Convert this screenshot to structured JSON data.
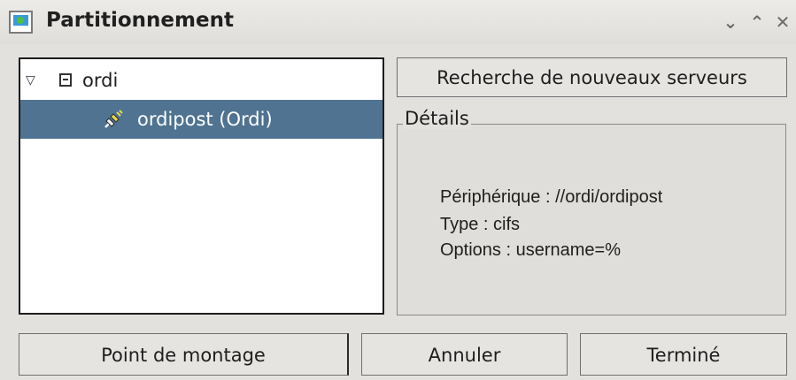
{
  "window": {
    "title": "Partitionnement",
    "controls": {
      "minimize": "⌄",
      "maximize": "⌃",
      "close": "✕"
    }
  },
  "tree": {
    "root": {
      "expander": "▽",
      "icon": "computer-icon",
      "label": "ordi"
    },
    "children": [
      {
        "icon": "network-share-icon",
        "label": "ordipost (Ordi)",
        "selected": true
      }
    ]
  },
  "search_button": "Recherche de nouveaux serveurs",
  "details": {
    "legend": "Détails",
    "lines": [
      "Périphérique : //ordi/ordipost",
      "Type : cifs",
      "Options : username=%"
    ]
  },
  "buttons": {
    "mount": "Point de montage",
    "cancel": "Annuler",
    "done": "Terminé"
  },
  "colors": {
    "selection": "#4f7391",
    "background": "#e3e1de"
  }
}
